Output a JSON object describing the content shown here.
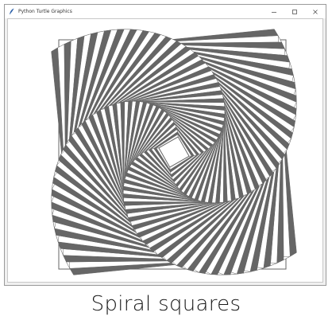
{
  "window": {
    "title": "Python Turtle Graphics",
    "controls": {
      "minimize_icon": "minimize-icon",
      "maximize_icon": "maximize-icon",
      "close_icon": "close-icon"
    }
  },
  "drawing": {
    "stroke_color": "#666666",
    "fill_color": "#666666",
    "background": "#ffffff"
  },
  "caption": "Spiral squares"
}
